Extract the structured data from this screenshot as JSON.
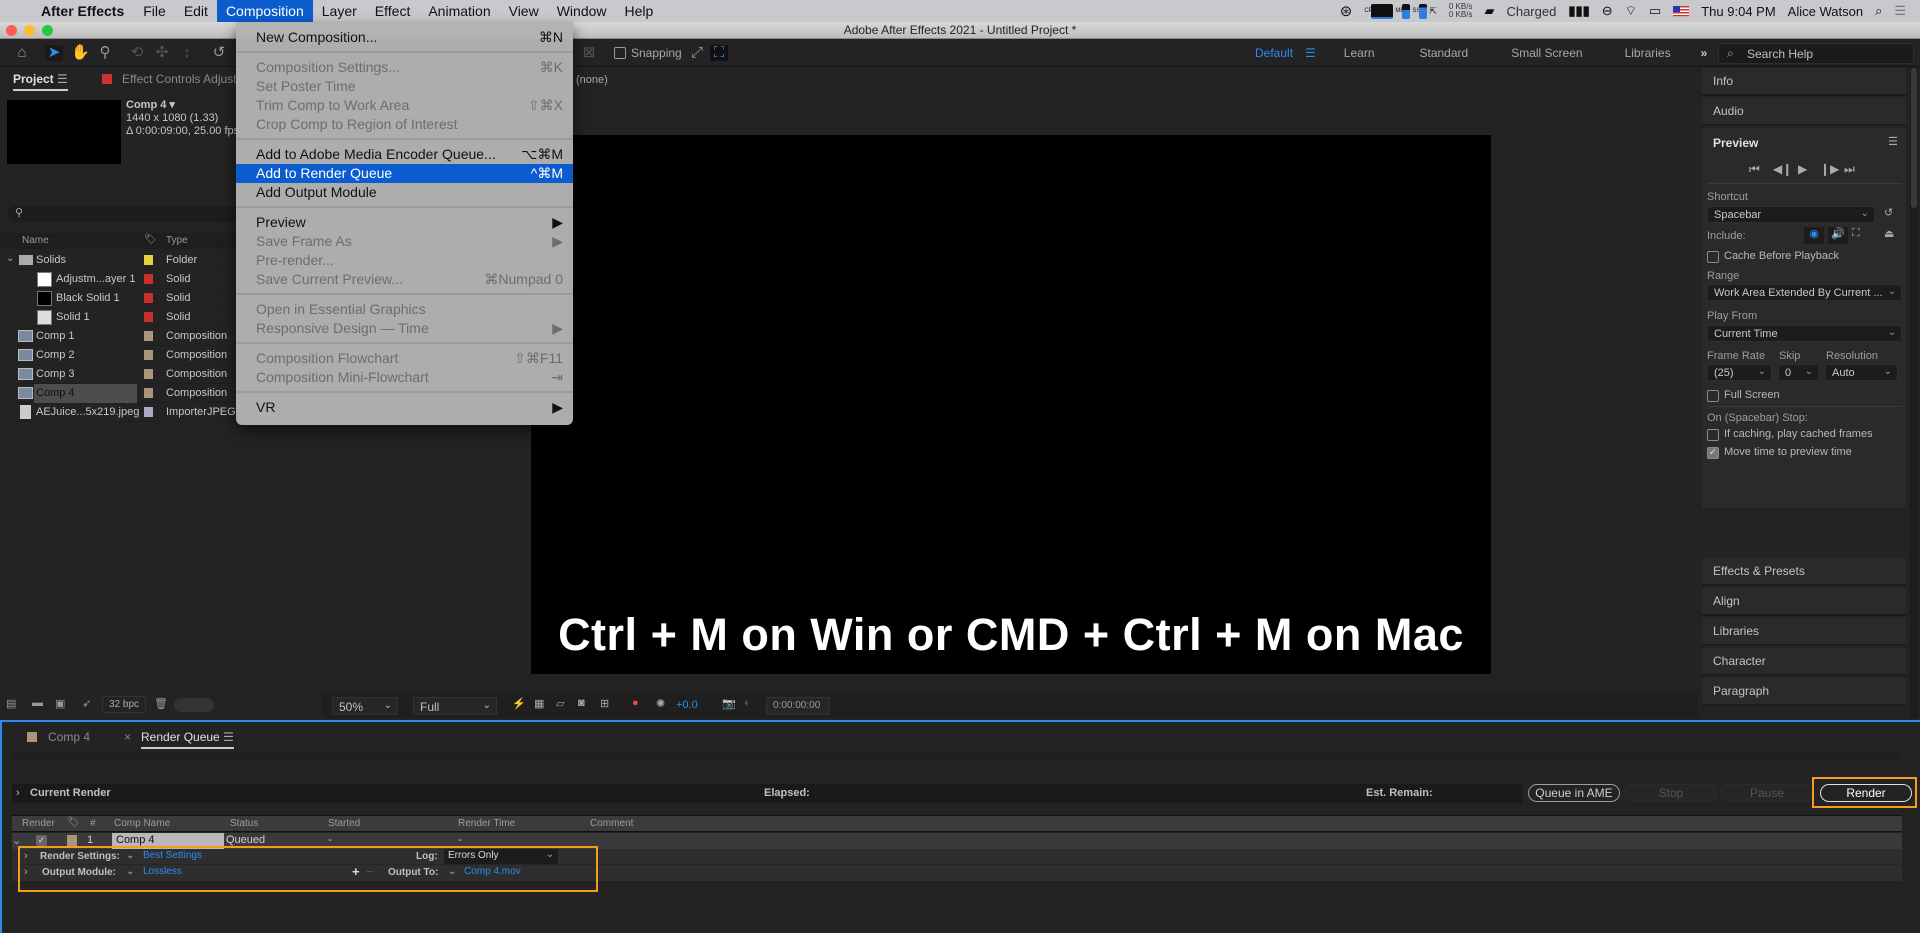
{
  "menubar": {
    "app_name": "After Effects",
    "items": [
      "File",
      "Edit",
      "Composition",
      "Layer",
      "Effect",
      "Animation",
      "View",
      "Window",
      "Help"
    ],
    "active_item": "Composition",
    "status": {
      "cpu_label": "CPU",
      "mem_label": "MEM",
      "ssd_label": "SSD",
      "net_up": "0 KB/s",
      "net_down": "0 KB/s",
      "battery_text": "Charged",
      "clock": "Thu 9:04 PM",
      "user": "Alice Watson"
    }
  },
  "window": {
    "title": "Adobe After Effects 2021 - Untitled Project *"
  },
  "toolbar": {
    "snapping_label": "Snapping",
    "snapping_checked": false,
    "workspaces": [
      "Default",
      "Learn",
      "Standard",
      "Small Screen",
      "Libraries"
    ],
    "active_workspace": "Default",
    "search_placeholder": "Search Help"
  },
  "project_panel": {
    "tab_project": "Project",
    "tab_effect_controls": "Effect Controls Adjustm",
    "selected_comp": {
      "name": "Comp 4",
      "resolution": "1440 x 1080 (1.33)",
      "duration": "Δ 0:00:09:00, 25.00 fps"
    },
    "columns": [
      "Name",
      "Type"
    ],
    "items": [
      {
        "name": "Solids",
        "type": "Folder",
        "label_color": "#e4d040",
        "kind": "folder",
        "indent": 0
      },
      {
        "name": "Adjustm...ayer 1",
        "type": "Solid",
        "label_color": "#c83030",
        "kind": "solid-white",
        "indent": 1
      },
      {
        "name": "Black Solid 1",
        "type": "Solid",
        "label_color": "#c83030",
        "kind": "solid-black",
        "indent": 1
      },
      {
        "name": "Solid 1",
        "type": "Solid",
        "label_color": "#c83030",
        "kind": "solid-light",
        "indent": 1
      },
      {
        "name": "Comp 1",
        "type": "Composition",
        "label_color": "#a8957a",
        "kind": "comp",
        "indent": 0
      },
      {
        "name": "Comp 2",
        "type": "Composition",
        "label_color": "#a8957a",
        "kind": "comp",
        "indent": 0
      },
      {
        "name": "Comp 3",
        "type": "Composition",
        "label_color": "#a8957a",
        "kind": "comp",
        "indent": 0
      },
      {
        "name": "Comp 4",
        "type": "Composition",
        "label_color": "#a8957a",
        "kind": "comp",
        "indent": 0,
        "selected": true
      },
      {
        "name": "AEJuice...5x219.jpeg",
        "type": "ImporterJPEG",
        "label_color": "#a8a8c8",
        "kind": "image",
        "indent": 0
      }
    ],
    "bit_depth": "32 bpc"
  },
  "composition_menu": {
    "items": [
      {
        "label": "New Composition...",
        "shortcut": "⌘N",
        "disabled": false
      },
      {
        "sep": true
      },
      {
        "label": "Composition Settings...",
        "shortcut": "⌘K",
        "disabled": true
      },
      {
        "label": "Set Poster Time",
        "shortcut": "",
        "disabled": true
      },
      {
        "label": "Trim Comp to Work Area",
        "shortcut": "⇧⌘X",
        "disabled": true
      },
      {
        "label": "Crop Comp to Region of Interest",
        "shortcut": "",
        "disabled": true
      },
      {
        "sep": true
      },
      {
        "label": "Add to Adobe Media Encoder Queue...",
        "shortcut": "⌥⌘M",
        "disabled": false
      },
      {
        "label": "Add to Render Queue",
        "shortcut": "^⌘M",
        "disabled": false,
        "highlighted": true
      },
      {
        "label": "Add Output Module",
        "shortcut": "",
        "disabled": false
      },
      {
        "sep": true
      },
      {
        "label": "Preview",
        "shortcut": "▶",
        "disabled": false
      },
      {
        "label": "Save Frame As",
        "shortcut": "▶",
        "disabled": true
      },
      {
        "label": "Pre-render...",
        "shortcut": "",
        "disabled": true
      },
      {
        "label": "Save Current Preview...",
        "shortcut": "⌘Numpad 0",
        "disabled": true
      },
      {
        "sep": true
      },
      {
        "label": "Open in Essential Graphics",
        "shortcut": "",
        "disabled": true
      },
      {
        "label": "Responsive Design — Time",
        "shortcut": "▶",
        "disabled": true
      },
      {
        "sep": true
      },
      {
        "label": "Composition Flowchart",
        "shortcut": "⇧⌘F11",
        "disabled": true
      },
      {
        "label": "Composition Mini-Flowchart",
        "shortcut": "⇥",
        "disabled": true
      },
      {
        "sep": true
      },
      {
        "label": "VR",
        "shortcut": "▶",
        "disabled": false
      }
    ]
  },
  "viewer": {
    "layer_label": "(none)",
    "caption": "Ctrl + M on Win or CMD + Ctrl + M on Mac",
    "zoom": "50%",
    "resolution": "Full",
    "exposure": "+0.0",
    "timecode": "0:00:00:00"
  },
  "right_panel": {
    "collapsed_top": [
      "Info",
      "Audio"
    ],
    "preview": {
      "title": "Preview",
      "shortcut_label": "Shortcut",
      "shortcut_value": "Spacebar",
      "include_label": "Include:",
      "cache_before_playback": {
        "label": "Cache Before Playback",
        "checked": false
      },
      "range_label": "Range",
      "range_value": "Work Area Extended By Current ...",
      "play_from_label": "Play From",
      "play_from_value": "Current Time",
      "frame_rate_label": "Frame Rate",
      "frame_rate_value": "(25)",
      "skip_label": "Skip",
      "skip_value": "0",
      "resolution_label": "Resolution",
      "resolution_value": "Auto",
      "full_screen": {
        "label": "Full Screen",
        "checked": false
      },
      "stop_label": "On (Spacebar) Stop:",
      "play_cached": {
        "label": "If caching, play cached frames",
        "checked": false
      },
      "move_time": {
        "label": "Move time to preview time",
        "checked": true
      }
    },
    "collapsed_bottom": [
      "Effects & Presets",
      "Align",
      "Libraries",
      "Character",
      "Paragraph"
    ]
  },
  "render_queue": {
    "tabs": [
      "Comp 4",
      "Render Queue"
    ],
    "active_tab": "Render Queue",
    "current_render_label": "Current Render",
    "elapsed_label": "Elapsed:",
    "est_remain_label": "Est. Remain:",
    "buttons": {
      "queue_ame": "Queue in AME",
      "stop": "Stop",
      "pause": "Pause",
      "render": "Render"
    },
    "columns": [
      "Render",
      "#",
      "Comp Name",
      "Status",
      "Started",
      "Render Time",
      "Comment"
    ],
    "rows": [
      {
        "checked": true,
        "num": "1",
        "comp_name": "Comp 4",
        "status": "Queued",
        "started": "-",
        "render_time": "-",
        "comment": ""
      }
    ],
    "render_settings_label": "Render Settings:",
    "render_settings_value": "Best Settings",
    "log_label": "Log:",
    "log_value": "Errors Only",
    "output_module_label": "Output Module:",
    "output_module_value": "Lossless",
    "output_to_label": "Output To:",
    "output_to_value": "Comp 4.mov"
  },
  "colors": {
    "accent_blue": "#2d8ceb",
    "highlight_orange": "#f39c1e",
    "menu_highlight": "#0b5cce"
  }
}
